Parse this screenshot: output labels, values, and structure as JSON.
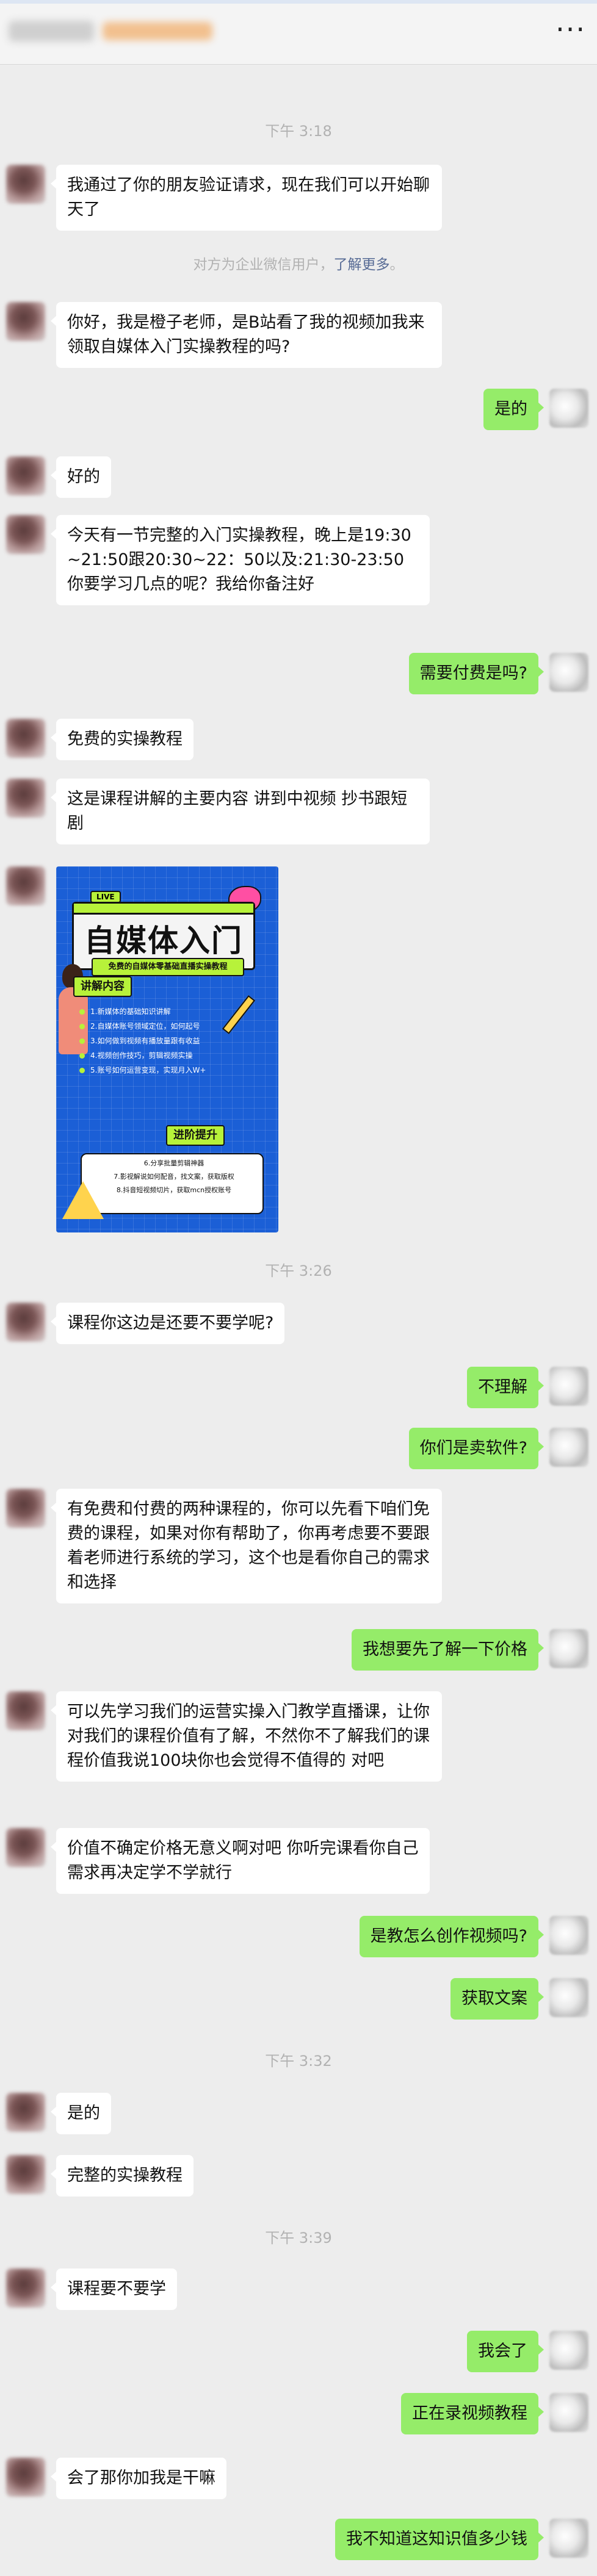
{
  "header": {
    "more_icon_label": "···"
  },
  "times": [
    "下午 3:18",
    "下午 3:26",
    "下午 3:32",
    "下午 3:39"
  ],
  "notice": {
    "text": "对方为企业微信用户，",
    "link": "了解更多",
    "suffix": "。"
  },
  "messages": [
    {
      "side": "left",
      "text": "我通过了你的朋友验证请求，现在我们可以开始聊天了"
    },
    {
      "side": "left",
      "text": "你好，我是橙子老师，是B站看了我的视频加我来领取自媒体入门实操教程的吗?"
    },
    {
      "side": "right",
      "text": "是的"
    },
    {
      "side": "left",
      "text": "好的"
    },
    {
      "side": "left",
      "text": "今天有一节完整的入门实操教程，晚上是19:30~21:50跟20:30~22：50以及:21:30-23:50你要学习几点的呢？我给你备注好"
    },
    {
      "side": "right",
      "text": "需要付费是吗?"
    },
    {
      "side": "left",
      "text": "免费的实操教程"
    },
    {
      "side": "left",
      "text": "这是课程讲解的主要内容  讲到中视频 抄书跟短剧"
    },
    {
      "side": "left",
      "text": "课程你这边是还要不要学呢?"
    },
    {
      "side": "right",
      "text": "不理解"
    },
    {
      "side": "right",
      "text": "你们是卖软件?"
    },
    {
      "side": "left",
      "text": "有免费和付费的两种课程的，你可以先看下咱们免费的课程，如果对你有帮助了，你再考虑要不要跟着老师进行系统的学习，这个也是看你自己的需求和选择"
    },
    {
      "side": "right",
      "text": "我想要先了解一下价格"
    },
    {
      "side": "left",
      "text": "可以先学习我们的运营实操入门教学直播课，让你对我们的课程价值有了解，不然你不了解我们的课程价值我说100块你也会觉得不值得的 对吧"
    },
    {
      "side": "left",
      "text": "价值不确定价格无意义啊对吧 你听完课看你自己需求再决定学不学就行"
    },
    {
      "side": "right",
      "text": "是教怎么创作视频吗?"
    },
    {
      "side": "right",
      "text": "获取文案"
    },
    {
      "side": "left",
      "text": "是的"
    },
    {
      "side": "left",
      "text": "完整的实操教程"
    },
    {
      "side": "left",
      "text": "课程要不要学"
    },
    {
      "side": "right",
      "text": "我会了"
    },
    {
      "side": "right",
      "text": "正在录视频教程"
    },
    {
      "side": "left",
      "text": "会了那你加我是干嘛"
    },
    {
      "side": "right",
      "text": "我不知道这知识值多少钱"
    }
  ],
  "poster": {
    "badge": "LIVE",
    "title": "自媒体入门",
    "subtitle": "免费的自媒体零基础直播实操教程",
    "section": "讲解内容",
    "items": [
      "1.新媒体的基础知识讲解",
      "2.自媒体账号领域定位，如何起号",
      "3.如何做到视频有播放量跟有收益",
      "4.视频创作技巧，剪辑视频实操",
      "5.账号如何运营变现，实现月入W+"
    ],
    "advanced": "进阶提升",
    "advanced_items": [
      "6.分享批量剪辑神器",
      "7.影视解说如何配音，找文案，获取版权",
      "8.抖音短视频切片，获取mcn授权账号"
    ]
  }
}
